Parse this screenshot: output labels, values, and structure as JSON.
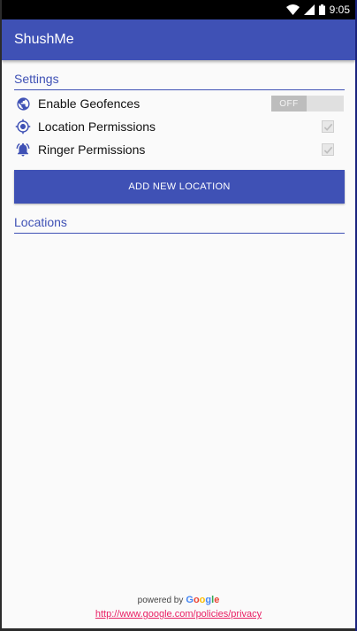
{
  "status_bar": {
    "time": "9:05"
  },
  "app_bar": {
    "title": "ShushMe"
  },
  "settings": {
    "section_title": "Settings",
    "enable_geofences": {
      "label": "Enable Geofences",
      "toggle_state": "OFF"
    },
    "location_permissions": {
      "label": "Location Permissions",
      "checked": true
    },
    "ringer_permissions": {
      "label": "Ringer Permissions",
      "checked": true
    }
  },
  "add_button_label": "ADD NEW LOCATION",
  "locations": {
    "section_title": "Locations"
  },
  "footer": {
    "powered_by": "powered by",
    "google": "Google",
    "privacy_link": "http://www.google.com/policies/privacy"
  },
  "colors": {
    "primary": "#3f51b5",
    "link": "#e91e63"
  },
  "icons": {
    "geofence": "globe-icon",
    "location": "gps-target-icon",
    "ringer": "ringing-bell-icon"
  }
}
